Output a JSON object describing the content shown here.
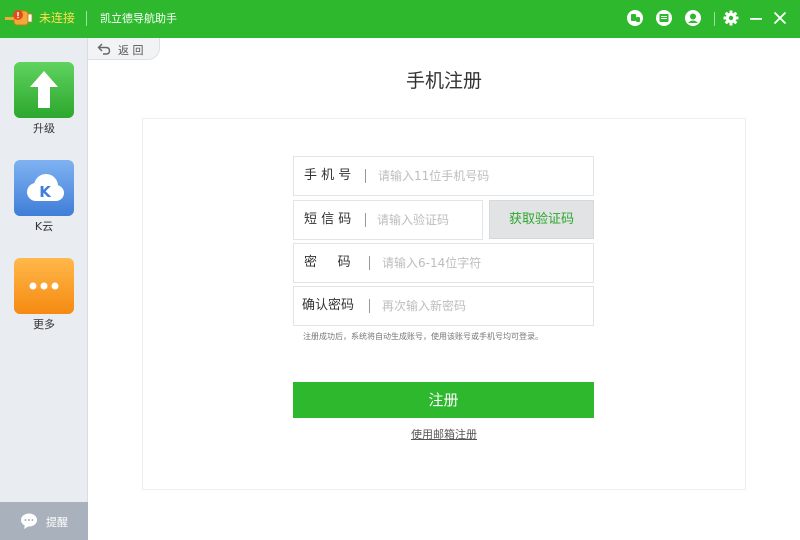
{
  "titlebar": {
    "connection_status": "未连接",
    "app_title": "凯立德导航助手",
    "icons": [
      "device-icon",
      "message-icon",
      "user-icon",
      "settings-icon",
      "minimize-icon",
      "close-icon"
    ]
  },
  "sidebar": {
    "items": [
      {
        "label": "升级",
        "icon": "upgrade-arrow-icon",
        "color": "#2db82d"
      },
      {
        "label": "K云",
        "icon": "k-cloud-icon",
        "color": "#3f7ed8"
      },
      {
        "label": "更多",
        "icon": "more-dots-icon",
        "color": "#f58a12"
      }
    ],
    "bottom": {
      "label": "提醒",
      "icon": "chat-bubble-icon"
    }
  },
  "nav": {
    "back_label": "返 回"
  },
  "main": {
    "title": "手机注册",
    "fields": {
      "phone": {
        "label": "手 机 号",
        "placeholder": "请输入11位手机号码",
        "value": ""
      },
      "sms": {
        "label": "短 信 码",
        "placeholder": "请输入验证码",
        "value": ""
      },
      "password": {
        "label": "密     码",
        "placeholder": "请输入6-14位字符",
        "value": ""
      },
      "confirm": {
        "label": "确认密码",
        "placeholder": "再次输入新密码",
        "value": ""
      }
    },
    "get_code_label": "获取验证码",
    "hint": "注册成功后，系统将自动生成账号，使用该账号或手机号均可登录。",
    "register_label": "注册",
    "email_link": "使用邮箱注册"
  },
  "colors": {
    "brand": "#2db82d",
    "status_text": "#ffe14d",
    "sidebar_bg": "#e9edf1"
  }
}
